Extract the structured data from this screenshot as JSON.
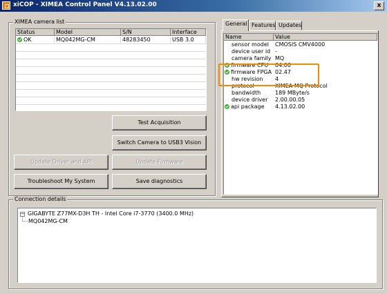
{
  "window": {
    "title": "xiCOP - XIMEA Control Panel V4.13.02.00",
    "close_glyph": "x"
  },
  "camera_list": {
    "label": "XIMEA camera list",
    "columns": [
      "Status",
      "Model",
      "S/N",
      "Interface"
    ],
    "rows": [
      {
        "status": "OK",
        "model": "MQ042MG-CM",
        "sn": "48283450",
        "interface": "USB 3.0"
      }
    ]
  },
  "buttons": {
    "test_acquisition": "Test Acquisition",
    "switch_usb3": "Switch Camera to USB3 Vision",
    "update_driver": "Update Driver and API",
    "update_firmware": "Update Firmware",
    "troubleshoot": "Troubleshoot My System",
    "save_diagnostics": "Save diagnostics"
  },
  "tabs": {
    "general": "General",
    "features": "Features",
    "updates": "Updates"
  },
  "properties": {
    "columns": [
      "Name",
      "Value"
    ],
    "rows": [
      {
        "name": "sensor model",
        "value": "CMOSIS CMV4000",
        "check": false
      },
      {
        "name": "device user id",
        "value": "-",
        "check": false
      },
      {
        "name": "camera family",
        "value": "MQ",
        "check": false
      },
      {
        "name": "firmware CPU",
        "value": "04.00",
        "check": true
      },
      {
        "name": "firmware FPGA",
        "value": "02.47",
        "check": true
      },
      {
        "name": "hw revision",
        "value": "4",
        "check": false
      },
      {
        "name": "protocol",
        "value": "XIMEA MQ Protocol",
        "check": false
      },
      {
        "name": "bandwidth",
        "value": "189 MByte/s",
        "check": false
      },
      {
        "name": "device driver",
        "value": "2.00.00.05",
        "check": false
      },
      {
        "name": "api package",
        "value": "4.13.02.00",
        "check": true
      }
    ]
  },
  "connection": {
    "label": "Connection details",
    "root": "GIGABYTE Z77MX-D3H TH - Intel Core i7-3770 (3400.0 MHz)",
    "child": "MQ042MG-CM",
    "expander": "−"
  },
  "colors": {
    "highlight": "#f08a00",
    "ok_check": "#3cae2c",
    "title_bar": "#0a246a"
  }
}
